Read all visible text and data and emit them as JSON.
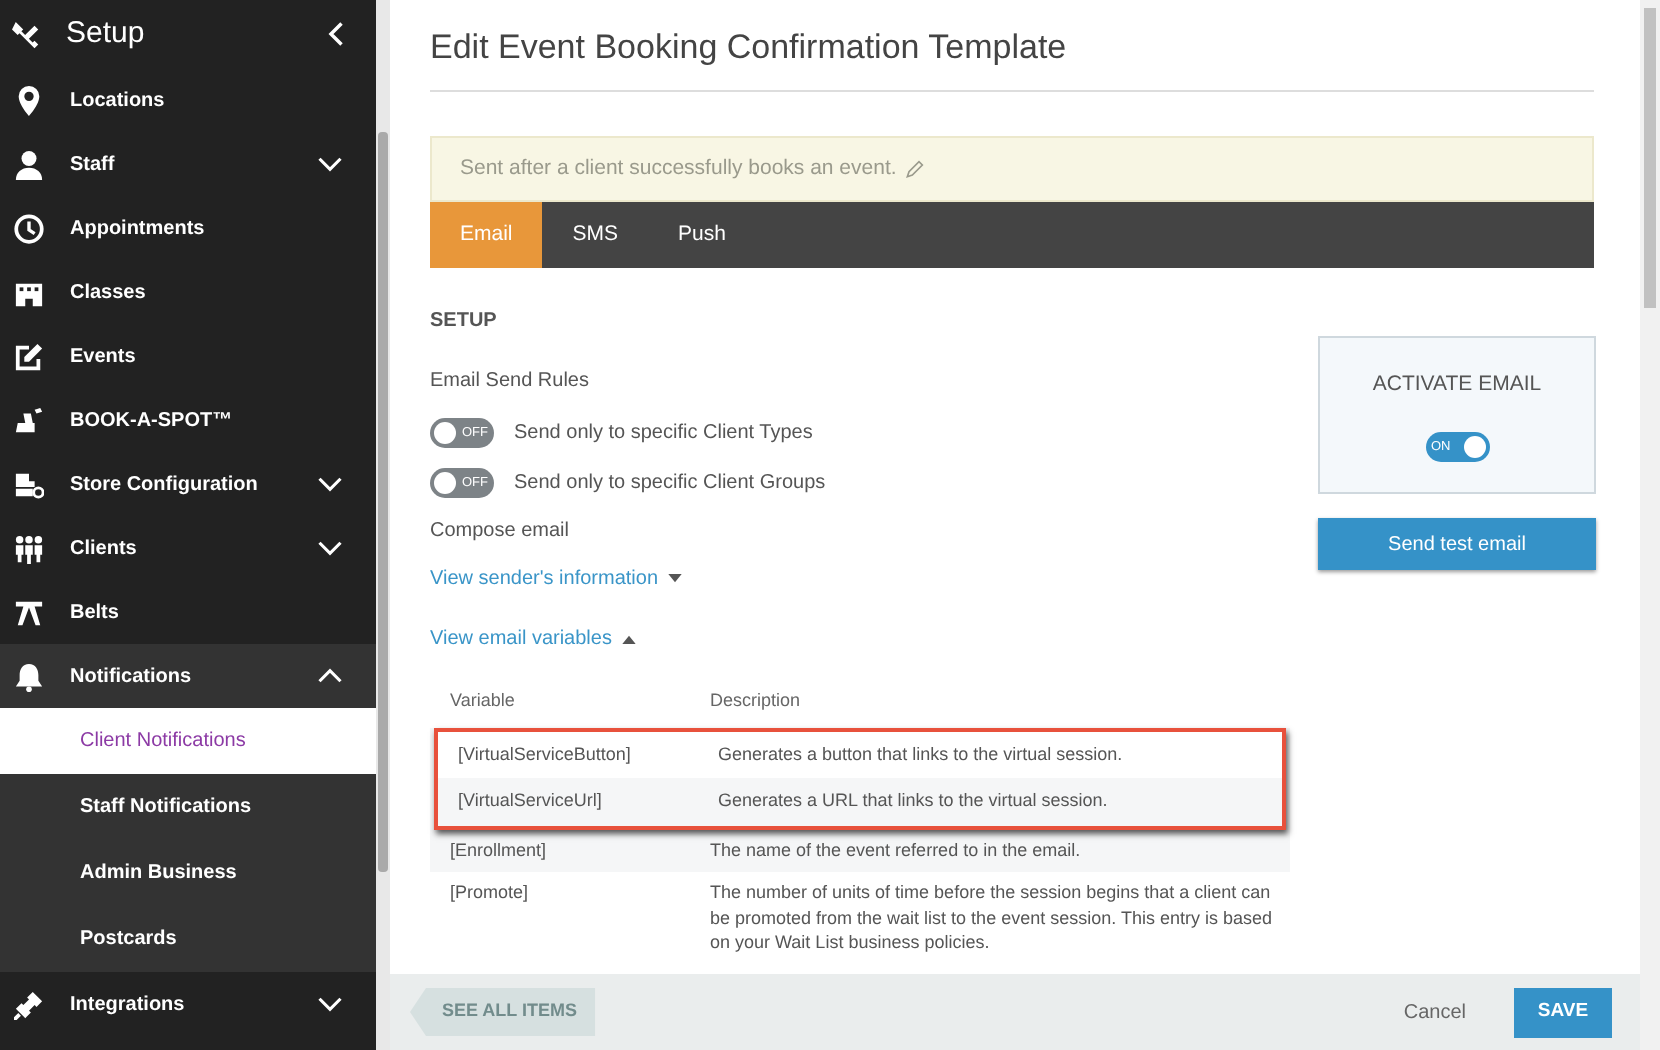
{
  "sidebar": {
    "title": "Setup",
    "items": [
      {
        "label": "Locations"
      },
      {
        "label": "Staff",
        "expanded": false
      },
      {
        "label": "Appointments"
      },
      {
        "label": "Classes"
      },
      {
        "label": "Events"
      },
      {
        "label": "BOOK-A-SPOT™"
      },
      {
        "label": "Store Configuration",
        "expanded": false
      },
      {
        "label": "Clients",
        "expanded": false
      },
      {
        "label": "Belts"
      },
      {
        "label": "Notifications",
        "expanded": true,
        "children": [
          {
            "label": "Client Notifications",
            "selected": true
          },
          {
            "label": "Staff Notifications",
            "selected": false
          },
          {
            "label": "Admin Business",
            "selected": false
          },
          {
            "label": "Postcards",
            "selected": false
          }
        ]
      },
      {
        "label": "Integrations",
        "expanded": false
      }
    ]
  },
  "page": {
    "title": "Edit Event Booking Confirmation Template",
    "note": "Sent after a client successfully books an event.",
    "tabs": [
      {
        "label": "Email",
        "selected": true
      },
      {
        "label": "SMS",
        "selected": false
      },
      {
        "label": "Push",
        "selected": false
      }
    ],
    "section_title": "SETUP",
    "send_rules_label": "Email Send Rules",
    "rules": [
      {
        "toggle": "OFF",
        "on": false,
        "label": "Send only to specific Client Types"
      },
      {
        "toggle": "OFF",
        "on": false,
        "label": "Send only to specific Client Groups"
      }
    ],
    "compose_label": "Compose email",
    "links": [
      {
        "label": "View sender's information",
        "expanded": false
      },
      {
        "label": "View email variables",
        "expanded": true
      }
    ],
    "activate": {
      "title": "ACTIVATE EMAIL",
      "toggle": "ON",
      "on": true
    },
    "test_button": "Send test email",
    "table": {
      "columns": [
        "Variable",
        "Description"
      ],
      "rows": [
        {
          "variable": "[VirtualServiceButton]",
          "description": "Generates a button that links to the virtual session.",
          "highlighted": true
        },
        {
          "variable": "[VirtualServiceUrl]",
          "description": "Generates a URL that links to the virtual session.",
          "highlighted": true
        },
        {
          "variable": "[Enrollment]",
          "description": "The name of the event referred to in the email.",
          "highlighted": false
        },
        {
          "variable": "[Promote]",
          "description": "The number of units of time before the session begins that a client can be promoted from the wait list to the event session. This entry is based on your Wait List business policies.",
          "highlighted": false
        }
      ]
    }
  },
  "footer": {
    "back_button": "SEE ALL ITEMS",
    "cancel": "Cancel",
    "save": "SAVE"
  }
}
